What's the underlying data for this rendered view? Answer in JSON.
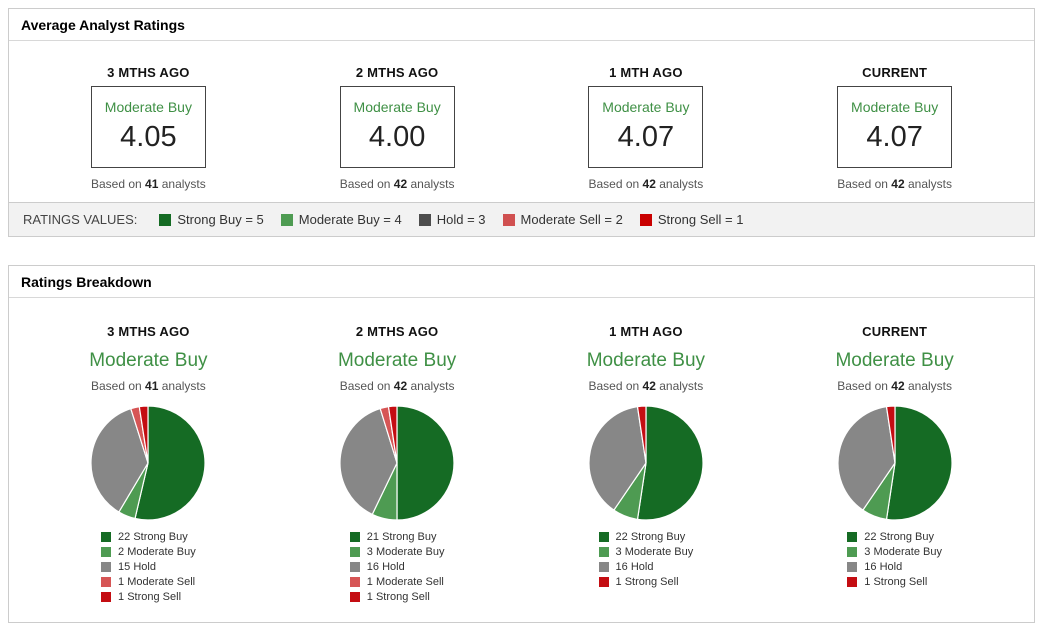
{
  "panel1": {
    "title": "Average Analyst Ratings",
    "based_prefix": "Based on",
    "based_suffix": "analysts",
    "columns": [
      {
        "label": "3 MTHS AGO",
        "rating": "Moderate Buy",
        "value": "4.05",
        "analysts": "41"
      },
      {
        "label": "2 MTHS AGO",
        "rating": "Moderate Buy",
        "value": "4.00",
        "analysts": "42"
      },
      {
        "label": "1 MTH AGO",
        "rating": "Moderate Buy",
        "value": "4.07",
        "analysts": "42"
      },
      {
        "label": "CURRENT",
        "rating": "Moderate Buy",
        "value": "4.07",
        "analysts": "42"
      }
    ],
    "ratings_values": {
      "label": "RATINGS VALUES:",
      "items": [
        {
          "label": "Strong Buy = 5",
          "color": "#156b24"
        },
        {
          "label": "Moderate Buy = 4",
          "color": "#4e9b52"
        },
        {
          "label": "Hold = 3",
          "color": "#4d4d4d"
        },
        {
          "label": "Moderate Sell = 2",
          "color": "#d05050"
        },
        {
          "label": "Strong Sell = 1",
          "color": "#c90000"
        }
      ]
    }
  },
  "panel2": {
    "title": "Ratings Breakdown",
    "based_prefix": "Based on",
    "based_suffix": "analysts",
    "columns": [
      {
        "label": "3 MTHS AGO",
        "rating": "Moderate Buy",
        "analysts": "41"
      },
      {
        "label": "2 MTHS AGO",
        "rating": "Moderate Buy",
        "analysts": "42"
      },
      {
        "label": "1 MTH AGO",
        "rating": "Moderate Buy",
        "analysts": "42"
      },
      {
        "label": "CURRENT",
        "rating": "Moderate Buy",
        "analysts": "42"
      }
    ]
  },
  "chart_data": [
    {
      "type": "table",
      "title": "Average Analyst Ratings",
      "categories": [
        "3 MTHS AGO",
        "2 MTHS AGO",
        "1 MTH AGO",
        "CURRENT"
      ],
      "values": [
        4.05,
        4.0,
        4.07,
        4.07
      ],
      "analysts": [
        41,
        42,
        42,
        42
      ],
      "ratings": [
        "Moderate Buy",
        "Moderate Buy",
        "Moderate Buy",
        "Moderate Buy"
      ],
      "scale_note": "Strong Buy = 5, Moderate Buy = 4, Hold = 3, Moderate Sell = 2, Strong Sell = 1"
    },
    {
      "type": "pie",
      "title": "3 MTHS AGO",
      "rating": "Moderate Buy",
      "analysts": 41,
      "slices": [
        {
          "name": "Strong Buy",
          "value": 22,
          "color": "#156b24"
        },
        {
          "name": "Moderate Buy",
          "value": 2,
          "color": "#4e9b52"
        },
        {
          "name": "Hold",
          "value": 15,
          "color": "#878787"
        },
        {
          "name": "Moderate Sell",
          "value": 1,
          "color": "#d65555"
        },
        {
          "name": "Strong Sell",
          "value": 1,
          "color": "#c40d12"
        }
      ]
    },
    {
      "type": "pie",
      "title": "2 MTHS AGO",
      "rating": "Moderate Buy",
      "analysts": 42,
      "slices": [
        {
          "name": "Strong Buy",
          "value": 21,
          "color": "#156b24"
        },
        {
          "name": "Moderate Buy",
          "value": 3,
          "color": "#4e9b52"
        },
        {
          "name": "Hold",
          "value": 16,
          "color": "#878787"
        },
        {
          "name": "Moderate Sell",
          "value": 1,
          "color": "#d65555"
        },
        {
          "name": "Strong Sell",
          "value": 1,
          "color": "#c40d12"
        }
      ]
    },
    {
      "type": "pie",
      "title": "1 MTH AGO",
      "rating": "Moderate Buy",
      "analysts": 42,
      "slices": [
        {
          "name": "Strong Buy",
          "value": 22,
          "color": "#156b24"
        },
        {
          "name": "Moderate Buy",
          "value": 3,
          "color": "#4e9b52"
        },
        {
          "name": "Hold",
          "value": 16,
          "color": "#878787"
        },
        {
          "name": "Strong Sell",
          "value": 1,
          "color": "#c40d12"
        }
      ]
    },
    {
      "type": "pie",
      "title": "CURRENT",
      "rating": "Moderate Buy",
      "analysts": 42,
      "slices": [
        {
          "name": "Strong Buy",
          "value": 22,
          "color": "#156b24"
        },
        {
          "name": "Moderate Buy",
          "value": 3,
          "color": "#4e9b52"
        },
        {
          "name": "Hold",
          "value": 16,
          "color": "#878787"
        },
        {
          "name": "Strong Sell",
          "value": 1,
          "color": "#c40d12"
        }
      ]
    }
  ]
}
